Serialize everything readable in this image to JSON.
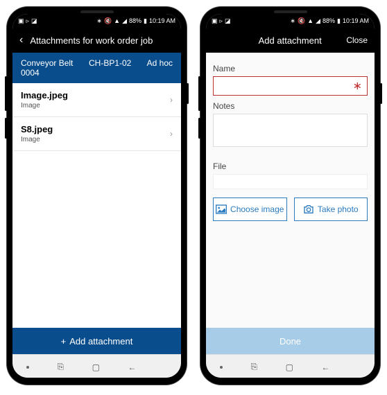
{
  "status": {
    "battery": "88%",
    "time": "10:19 AM"
  },
  "left_phone": {
    "title": "Attachments for work order job",
    "subheader": {
      "asset": "Conveyor Belt 0004",
      "code": "CH-BP1-02",
      "type": "Ad hoc"
    },
    "items": [
      {
        "name": "Image.jpeg",
        "type": "Image"
      },
      {
        "name": "S8.jpeg",
        "type": "Image"
      }
    ],
    "footer_label": "Add attachment"
  },
  "right_phone": {
    "title": "Add attachment",
    "close_label": "Close",
    "labels": {
      "name": "Name",
      "notes": "Notes",
      "file": "File"
    },
    "buttons": {
      "choose_image": "Choose image",
      "take_photo": "Take photo",
      "done": "Done"
    },
    "name_value": "",
    "notes_value": ""
  }
}
